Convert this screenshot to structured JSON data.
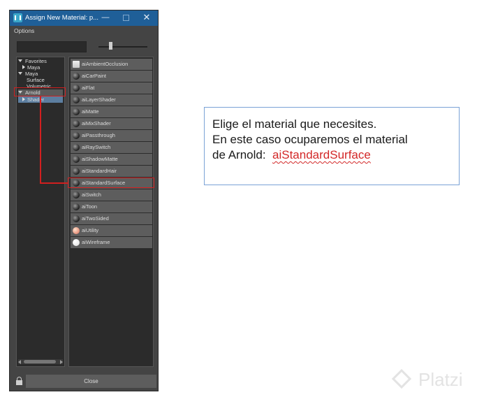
{
  "window": {
    "title": "Assign New Material: p...",
    "menu": "Options",
    "close_button": "Close",
    "minimize": "—",
    "close_glyph": "✕"
  },
  "tree": {
    "favorites": "Favorites",
    "maya_child": "Maya",
    "maya": "Maya",
    "surface": "Surface",
    "volumetric": "Volumetric",
    "arnold": "Arnold",
    "shader": "Shader"
  },
  "materials": [
    {
      "label": "aiAmbientOcclusion",
      "swatch": "square"
    },
    {
      "label": "aiCarPaint",
      "swatch": "dark"
    },
    {
      "label": "aiFlat",
      "swatch": "dark"
    },
    {
      "label": "aiLayerShader",
      "swatch": "dark"
    },
    {
      "label": "aiMatte",
      "swatch": "dark"
    },
    {
      "label": "aiMixShader",
      "swatch": "dark"
    },
    {
      "label": "aiPassthrough",
      "swatch": "dark"
    },
    {
      "label": "aiRaySwitch",
      "swatch": "dark"
    },
    {
      "label": "aiShadowMatte",
      "swatch": "dark"
    },
    {
      "label": "aiStandardHair",
      "swatch": "dark"
    },
    {
      "label": "aiStandardSurface",
      "swatch": "dark"
    },
    {
      "label": "aiSwitch",
      "swatch": "dark"
    },
    {
      "label": "aiToon",
      "swatch": "dark"
    },
    {
      "label": "aiTwoSided",
      "swatch": "dark"
    },
    {
      "label": "aiUtility",
      "swatch": "pink"
    },
    {
      "label": "aiWireframe",
      "swatch": "white"
    }
  ],
  "note": {
    "line1": "Elige el material que necesites.",
    "line2": "En este caso ocuparemos el material",
    "line3_prefix": "de Arnold:",
    "line3_accent": "aiStandardSurface"
  },
  "watermark": "Platzi",
  "colors": {
    "titlebar": "#1f5f98",
    "highlight": "#d11f1f",
    "panel": "#444444"
  }
}
